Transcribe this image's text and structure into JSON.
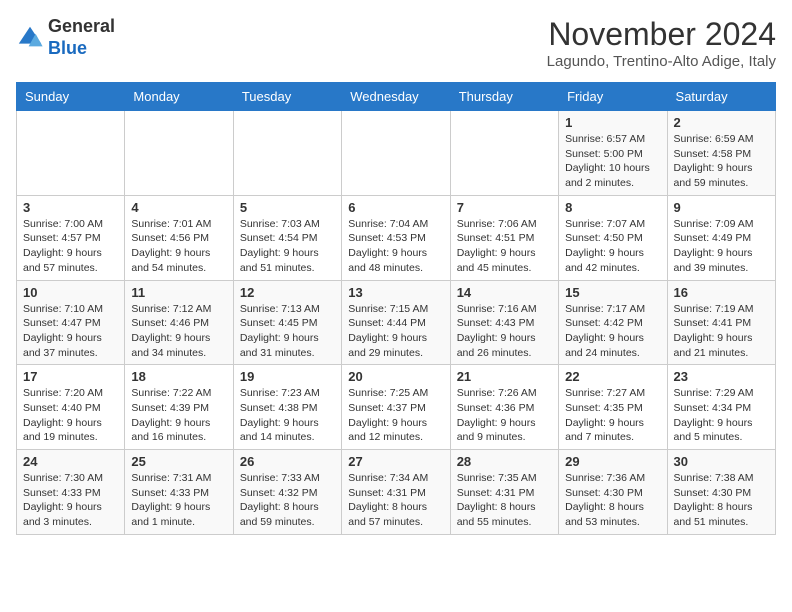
{
  "logo": {
    "general": "General",
    "blue": "Blue"
  },
  "title": "November 2024",
  "location": "Lagundo, Trentino-Alto Adige, Italy",
  "weekdays": [
    "Sunday",
    "Monday",
    "Tuesday",
    "Wednesday",
    "Thursday",
    "Friday",
    "Saturday"
  ],
  "weeks": [
    [
      {
        "day": "",
        "info": ""
      },
      {
        "day": "",
        "info": ""
      },
      {
        "day": "",
        "info": ""
      },
      {
        "day": "",
        "info": ""
      },
      {
        "day": "",
        "info": ""
      },
      {
        "day": "1",
        "info": "Sunrise: 6:57 AM\nSunset: 5:00 PM\nDaylight: 10 hours\nand 2 minutes."
      },
      {
        "day": "2",
        "info": "Sunrise: 6:59 AM\nSunset: 4:58 PM\nDaylight: 9 hours\nand 59 minutes."
      }
    ],
    [
      {
        "day": "3",
        "info": "Sunrise: 7:00 AM\nSunset: 4:57 PM\nDaylight: 9 hours\nand 57 minutes."
      },
      {
        "day": "4",
        "info": "Sunrise: 7:01 AM\nSunset: 4:56 PM\nDaylight: 9 hours\nand 54 minutes."
      },
      {
        "day": "5",
        "info": "Sunrise: 7:03 AM\nSunset: 4:54 PM\nDaylight: 9 hours\nand 51 minutes."
      },
      {
        "day": "6",
        "info": "Sunrise: 7:04 AM\nSunset: 4:53 PM\nDaylight: 9 hours\nand 48 minutes."
      },
      {
        "day": "7",
        "info": "Sunrise: 7:06 AM\nSunset: 4:51 PM\nDaylight: 9 hours\nand 45 minutes."
      },
      {
        "day": "8",
        "info": "Sunrise: 7:07 AM\nSunset: 4:50 PM\nDaylight: 9 hours\nand 42 minutes."
      },
      {
        "day": "9",
        "info": "Sunrise: 7:09 AM\nSunset: 4:49 PM\nDaylight: 9 hours\nand 39 minutes."
      }
    ],
    [
      {
        "day": "10",
        "info": "Sunrise: 7:10 AM\nSunset: 4:47 PM\nDaylight: 9 hours\nand 37 minutes."
      },
      {
        "day": "11",
        "info": "Sunrise: 7:12 AM\nSunset: 4:46 PM\nDaylight: 9 hours\nand 34 minutes."
      },
      {
        "day": "12",
        "info": "Sunrise: 7:13 AM\nSunset: 4:45 PM\nDaylight: 9 hours\nand 31 minutes."
      },
      {
        "day": "13",
        "info": "Sunrise: 7:15 AM\nSunset: 4:44 PM\nDaylight: 9 hours\nand 29 minutes."
      },
      {
        "day": "14",
        "info": "Sunrise: 7:16 AM\nSunset: 4:43 PM\nDaylight: 9 hours\nand 26 minutes."
      },
      {
        "day": "15",
        "info": "Sunrise: 7:17 AM\nSunset: 4:42 PM\nDaylight: 9 hours\nand 24 minutes."
      },
      {
        "day": "16",
        "info": "Sunrise: 7:19 AM\nSunset: 4:41 PM\nDaylight: 9 hours\nand 21 minutes."
      }
    ],
    [
      {
        "day": "17",
        "info": "Sunrise: 7:20 AM\nSunset: 4:40 PM\nDaylight: 9 hours\nand 19 minutes."
      },
      {
        "day": "18",
        "info": "Sunrise: 7:22 AM\nSunset: 4:39 PM\nDaylight: 9 hours\nand 16 minutes."
      },
      {
        "day": "19",
        "info": "Sunrise: 7:23 AM\nSunset: 4:38 PM\nDaylight: 9 hours\nand 14 minutes."
      },
      {
        "day": "20",
        "info": "Sunrise: 7:25 AM\nSunset: 4:37 PM\nDaylight: 9 hours\nand 12 minutes."
      },
      {
        "day": "21",
        "info": "Sunrise: 7:26 AM\nSunset: 4:36 PM\nDaylight: 9 hours\nand 9 minutes."
      },
      {
        "day": "22",
        "info": "Sunrise: 7:27 AM\nSunset: 4:35 PM\nDaylight: 9 hours\nand 7 minutes."
      },
      {
        "day": "23",
        "info": "Sunrise: 7:29 AM\nSunset: 4:34 PM\nDaylight: 9 hours\nand 5 minutes."
      }
    ],
    [
      {
        "day": "24",
        "info": "Sunrise: 7:30 AM\nSunset: 4:33 PM\nDaylight: 9 hours\nand 3 minutes."
      },
      {
        "day": "25",
        "info": "Sunrise: 7:31 AM\nSunset: 4:33 PM\nDaylight: 9 hours\nand 1 minute."
      },
      {
        "day": "26",
        "info": "Sunrise: 7:33 AM\nSunset: 4:32 PM\nDaylight: 8 hours\nand 59 minutes."
      },
      {
        "day": "27",
        "info": "Sunrise: 7:34 AM\nSunset: 4:31 PM\nDaylight: 8 hours\nand 57 minutes."
      },
      {
        "day": "28",
        "info": "Sunrise: 7:35 AM\nSunset: 4:31 PM\nDaylight: 8 hours\nand 55 minutes."
      },
      {
        "day": "29",
        "info": "Sunrise: 7:36 AM\nSunset: 4:30 PM\nDaylight: 8 hours\nand 53 minutes."
      },
      {
        "day": "30",
        "info": "Sunrise: 7:38 AM\nSunset: 4:30 PM\nDaylight: 8 hours\nand 51 minutes."
      }
    ]
  ]
}
